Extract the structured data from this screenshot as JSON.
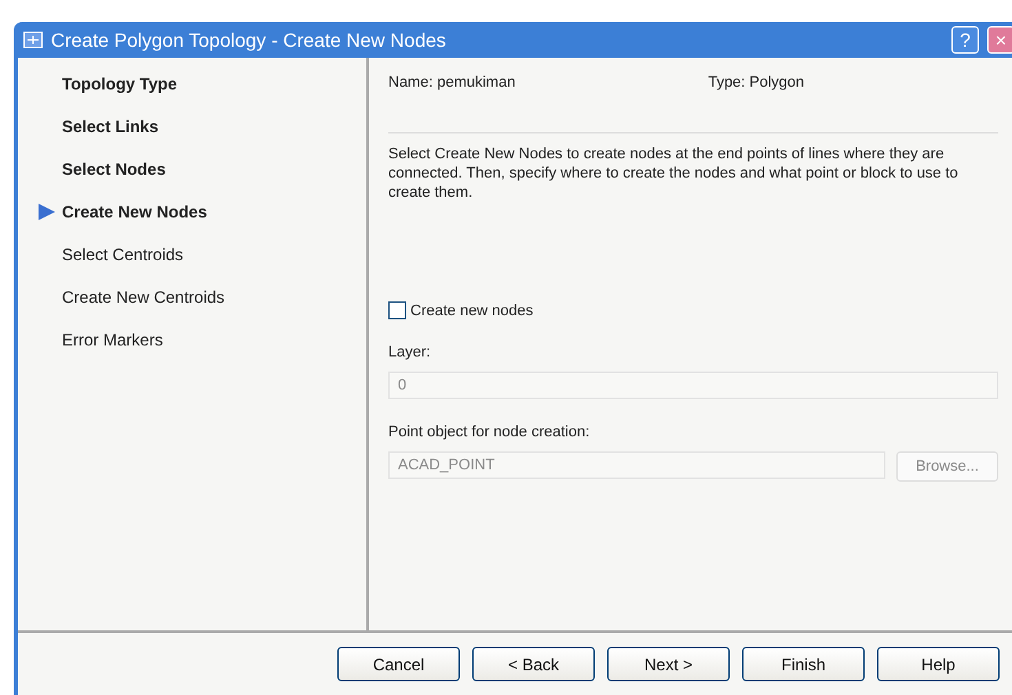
{
  "window": {
    "title": "Create Polygon Topology - Create New Nodes",
    "help_button": "?",
    "close_button": "×"
  },
  "steps": [
    {
      "label": "Topology Type",
      "completed": true,
      "selected": false
    },
    {
      "label": "Select Links",
      "completed": true,
      "selected": false
    },
    {
      "label": "Select Nodes",
      "completed": true,
      "selected": false
    },
    {
      "label": "Create New Nodes",
      "completed": true,
      "selected": true
    },
    {
      "label": "Select Centroids",
      "completed": false,
      "selected": false
    },
    {
      "label": "Create New Centroids",
      "completed": false,
      "selected": false
    },
    {
      "label": "Error Markers",
      "completed": false,
      "selected": false
    }
  ],
  "info": {
    "name": "Name: pemukiman",
    "type": "Type: Polygon"
  },
  "description": "Select Create New Nodes to create nodes at the end points of lines where they are connected. Then, specify where to create the nodes and what point or block to use to create them.",
  "create_nodes": {
    "label": "Create new nodes",
    "checked": false
  },
  "layer": {
    "label": "Layer:",
    "value": "0",
    "disabled": true
  },
  "point_object": {
    "label": "Point object for node creation:",
    "value": "ACAD_POINT",
    "disabled": true,
    "browse": "Browse...",
    "browse_disabled": true
  },
  "buttons": [
    "Cancel",
    "< Back",
    "Next >",
    "Finish",
    "Help"
  ]
}
